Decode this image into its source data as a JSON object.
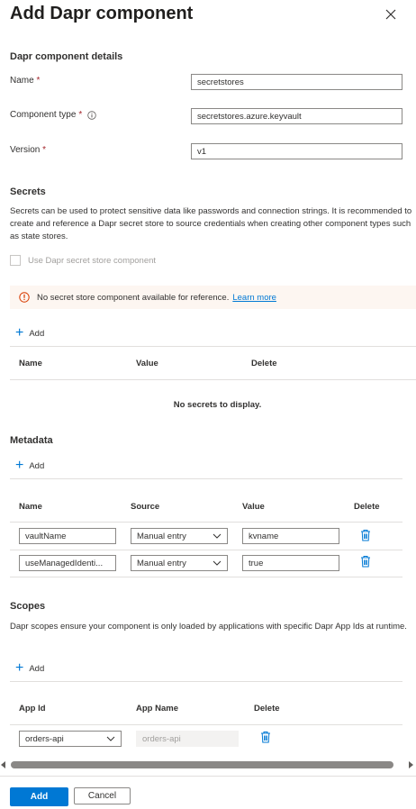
{
  "title": "Add Dapr component",
  "details": {
    "heading": "Dapr component details",
    "name_label": "Name",
    "name_value": "secretstores",
    "type_label": "Component type",
    "type_value": "secretstores.azure.keyvault",
    "version_label": "Version",
    "version_value": "v1",
    "required_mark": "*"
  },
  "secrets": {
    "heading": "Secrets",
    "description": "Secrets can be used to protect sensitive data like passwords and connection strings. It is recommended to create and reference a Dapr secret store to source credentials when creating other component types such as state stores.",
    "checkbox_label": "Use Dapr secret store component",
    "banner_text": "No secret store component available for reference.",
    "banner_link": "Learn more",
    "add_label": "Add",
    "columns": [
      "Name",
      "Value",
      "Delete"
    ],
    "empty_text": "No secrets to display."
  },
  "metadata": {
    "heading": "Metadata",
    "add_label": "Add",
    "columns": [
      "Name",
      "Source",
      "Value",
      "Delete"
    ],
    "rows": [
      {
        "name": "vaultName",
        "source": "Manual entry",
        "value": "kvname"
      },
      {
        "name": "useManagedIdenti...",
        "source": "Manual entry",
        "value": "true"
      }
    ]
  },
  "scopes": {
    "heading": "Scopes",
    "description": "Dapr scopes ensure your component is only loaded by applications with specific Dapr App Ids at runtime.",
    "add_label": "Add",
    "columns": [
      "App Id",
      "App Name",
      "Delete"
    ],
    "rows": [
      {
        "app_id": "orders-api",
        "app_name": "orders-api"
      }
    ]
  },
  "footer": {
    "add_label": "Add",
    "cancel_label": "Cancel"
  },
  "colors": {
    "accent": "#0078d4",
    "required": "#a4262c",
    "warning_bg": "#fdf6f1",
    "warning_icon": "#d83b01"
  }
}
